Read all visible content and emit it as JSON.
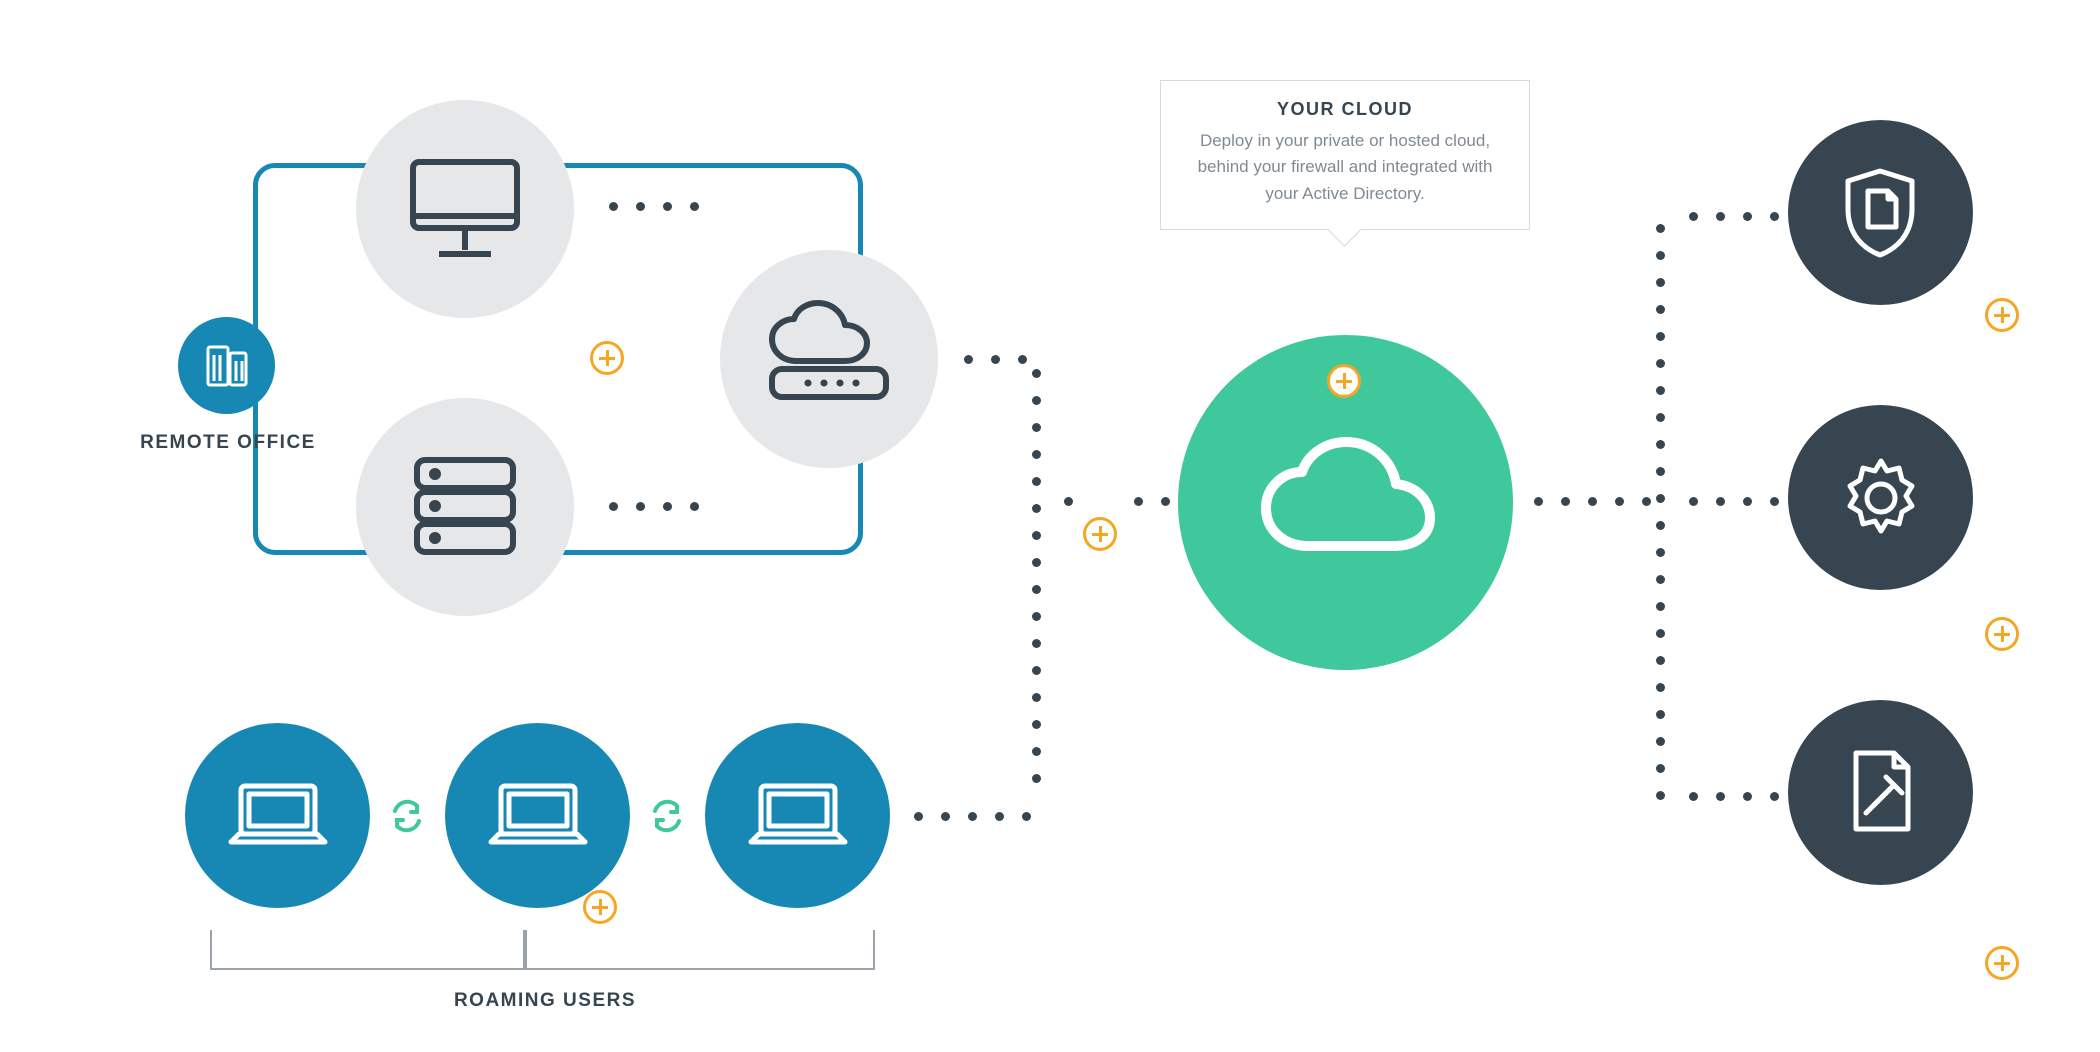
{
  "labels": {
    "remote_office": "REMOTE OFFICE",
    "roaming_users": "ROAMING USERS"
  },
  "tooltip": {
    "title": "YOUR CLOUD",
    "body": "Deploy in your private  or hosted cloud, behind your firewall and integrated with your Active Directory."
  },
  "colors": {
    "blue": "#1688b3",
    "navy": "#36454f",
    "green": "#3ec89c",
    "orange": "#f5a623",
    "grey": "#e5e7e9"
  },
  "nodes": {
    "remote_office_badge": "buildings-icon",
    "desktop": "desktop-monitor-icon",
    "server": "server-rack-icon",
    "edge_cloud": "cloud-appliance-icon",
    "your_cloud": "cloud-icon",
    "laptops": [
      "laptop-icon",
      "laptop-icon",
      "laptop-icon"
    ],
    "services": [
      "shield-document-icon",
      "gear-icon",
      "gavel-document-icon"
    ]
  }
}
